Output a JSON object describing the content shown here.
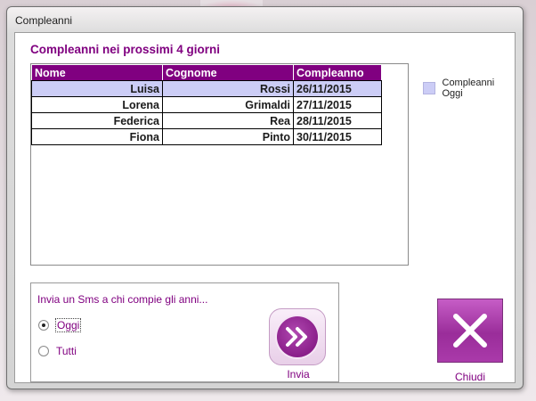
{
  "window": {
    "title": "Compleanni"
  },
  "heading": "Compleanni nei prossimi 4 giorni",
  "table": {
    "columns": [
      "Nome",
      "Cognome",
      "Compleanno"
    ],
    "rows": [
      {
        "nome": "Luisa",
        "cognome": "Rossi",
        "data": "26/11/2015",
        "today": true
      },
      {
        "nome": "Lorena",
        "cognome": "Grimaldi",
        "data": "27/11/2015",
        "today": false
      },
      {
        "nome": "Federica",
        "cognome": "Rea",
        "data": "28/11/2015",
        "today": false
      },
      {
        "nome": "Fiona",
        "cognome": "Pinto",
        "data": "30/11/2015",
        "today": false
      }
    ]
  },
  "legend": {
    "label": "Compleanni Oggi",
    "color": "#cccdf6"
  },
  "sms": {
    "title": "Invia un Sms a chi compie gli anni...",
    "options": [
      {
        "label": "Oggi",
        "selected": true
      },
      {
        "label": "Tutti",
        "selected": false
      }
    ]
  },
  "buttons": {
    "invia": "Invia",
    "chiudi": "Chiudi"
  },
  "colors": {
    "accent": "#800080",
    "highlight": "#cccdf6"
  },
  "icons": {
    "invia": "double-chevron-right-icon",
    "chiudi": "close-x-icon"
  }
}
